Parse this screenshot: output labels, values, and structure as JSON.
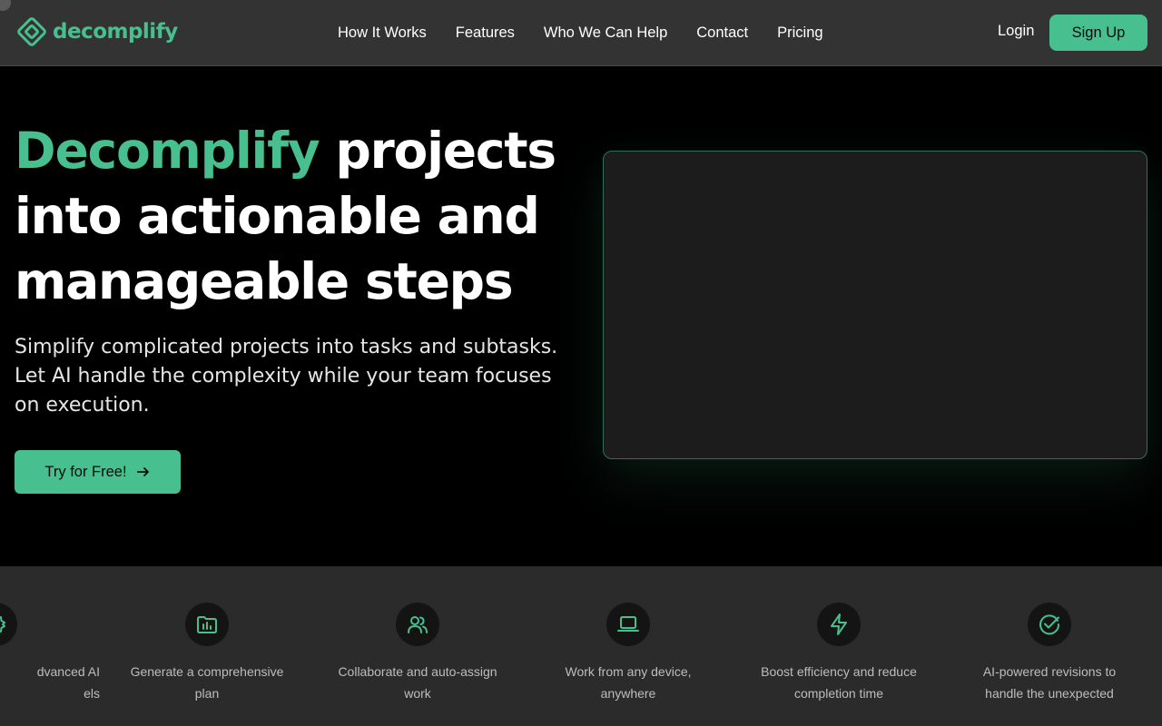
{
  "brand": {
    "name": "decomplify",
    "accent_color": "#47bf8e",
    "logo_icon": "diamond-logo-icon"
  },
  "nav": {
    "links": [
      "How It Works",
      "Features",
      "Who We Can Help",
      "Contact",
      "Pricing"
    ],
    "login_label": "Login",
    "signup_label": "Sign Up"
  },
  "hero": {
    "title_accent": "Decomplify",
    "title_rest": " projects into actionable and manageable steps",
    "subtitle": "Simplify complicated projects into tasks and subtasks. Let AI handle the complexity while your team focuses on execution.",
    "cta_label": "Try for Free!",
    "cta_icon": "arrow-right-icon"
  },
  "features": [
    {
      "icon": "gear-icon",
      "label": "Advanced AI models",
      "visible_label": "dvanced AI\nels"
    },
    {
      "icon": "chart-folder-icon",
      "label": "Generate a comprehensive plan"
    },
    {
      "icon": "users-icon",
      "label": "Collaborate and auto-assign work"
    },
    {
      "icon": "laptop-icon",
      "label": "Work from any device, anywhere"
    },
    {
      "icon": "lightning-icon",
      "label": "Boost efficiency and reduce completion time"
    },
    {
      "icon": "check-circle-icon",
      "label": "AI-powered revisions to handle the unexpected"
    }
  ]
}
